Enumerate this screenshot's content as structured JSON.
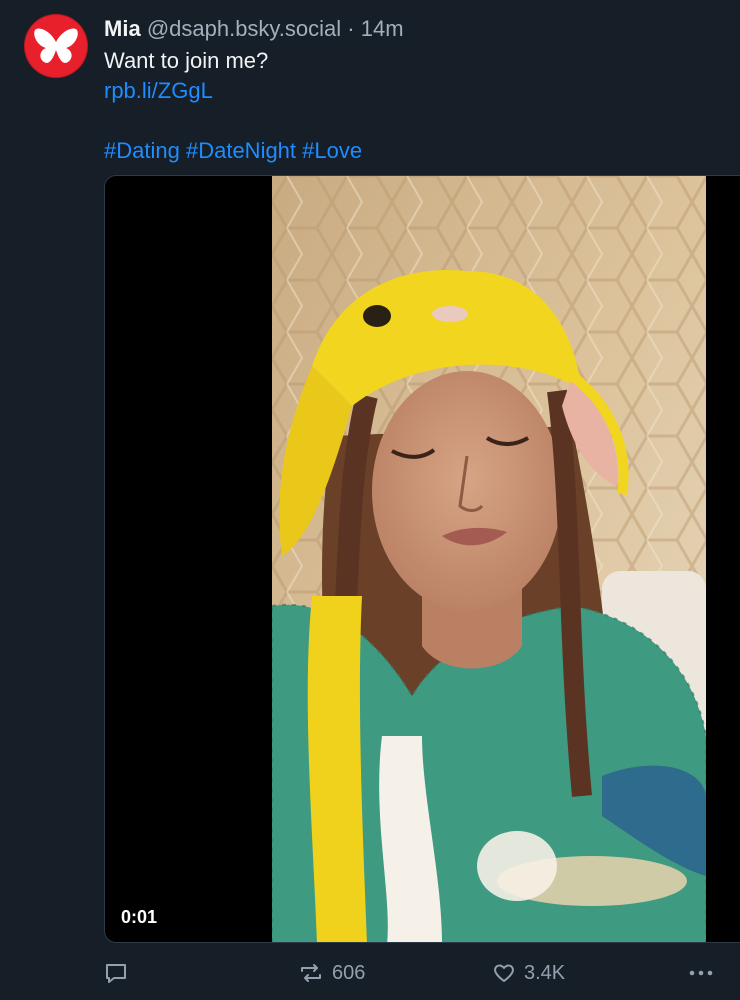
{
  "post": {
    "author_name": "Mia",
    "author_handle": "@dsaph.bsky.social",
    "separator": "·",
    "time": "14m",
    "text": "Want to join me?",
    "link": "rpb.li/ZGgL",
    "hashtags": [
      "#Dating",
      "#DateNight",
      "#Love"
    ]
  },
  "video": {
    "timestamp": "0:01"
  },
  "actions": {
    "reply_icon": "speech-bubble-icon",
    "repost_count": "606",
    "like_count": "3.4K",
    "more_icon": "ellipsis-icon"
  },
  "colors": {
    "background": "#161e27",
    "link": "#1f8cff",
    "muted": "#a3afbd",
    "avatar_bg": "#e8202c"
  }
}
